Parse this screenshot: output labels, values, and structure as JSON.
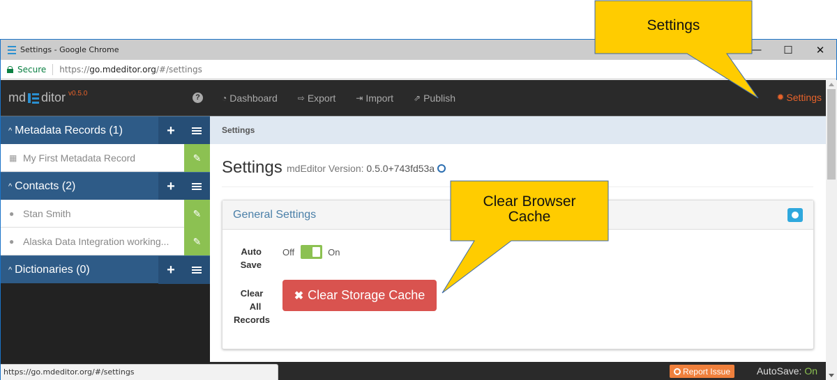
{
  "browser": {
    "window_title": "Settings - Google Chrome",
    "secure_label": "Secure",
    "url_scheme": "https://",
    "url_host": "go.mdeditor.org",
    "url_path": "/#/settings",
    "status_url": "https://go.mdeditor.org/#/settings",
    "minimize": "—",
    "maximize": "☐",
    "close": "✕"
  },
  "brand": {
    "prefix": "md",
    "suffix": "ditor",
    "version": "v0.5.0",
    "help": "?"
  },
  "sidebar": {
    "sections": [
      {
        "label": "Metadata Records (1)",
        "items": [
          {
            "icon": "table-icon",
            "glyph": "▦",
            "label": "My First Metadata Record"
          }
        ]
      },
      {
        "label": "Contacts (2)",
        "items": [
          {
            "icon": "user-icon",
            "glyph": "●",
            "label": "Stan Smith"
          },
          {
            "icon": "users-icon",
            "glyph": "●",
            "label": "Alaska Data Integration working..."
          }
        ]
      },
      {
        "label": "Dictionaries (0)",
        "items": []
      }
    ],
    "caret": "^",
    "plus": "+",
    "edit": "✎"
  },
  "nav": {
    "items": [
      {
        "glyph": "◔",
        "label": "Dashboard"
      },
      {
        "glyph": "⇨",
        "label": "Export"
      },
      {
        "glyph": "⇥",
        "label": "Import"
      },
      {
        "glyph": "⇗",
        "label": "Publish"
      }
    ],
    "settings": {
      "glyph": "✹",
      "label": "Settings"
    }
  },
  "breadcrumb": "Settings",
  "page": {
    "title": "Settings",
    "version_label": "mdEditor Version:",
    "version": "0.5.0+743fd53a"
  },
  "panel": {
    "title": "General Settings",
    "autosave_label_1": "Auto",
    "autosave_label_2": "Save",
    "off": "Off",
    "on": "On",
    "autosave_on": true,
    "clear_label_1": "Clear",
    "clear_label_2": "All",
    "clear_label_3": "Records",
    "clear_button_x": "✖",
    "clear_button": "Clear Storage Cache"
  },
  "footer": {
    "report_issue": "Report Issue",
    "autosave_label": "AutoSave:",
    "autosave_value": "On"
  },
  "callouts": {
    "settings": "Settings",
    "cache_line1": "Clear Browser",
    "cache_line2": "Cache"
  },
  "colors": {
    "accent_orange": "#e8632a",
    "sidebar_blue": "#2e5b87",
    "edit_green": "#8cc152",
    "danger_red": "#d9534f",
    "callout_yellow": "#ffcc00"
  }
}
